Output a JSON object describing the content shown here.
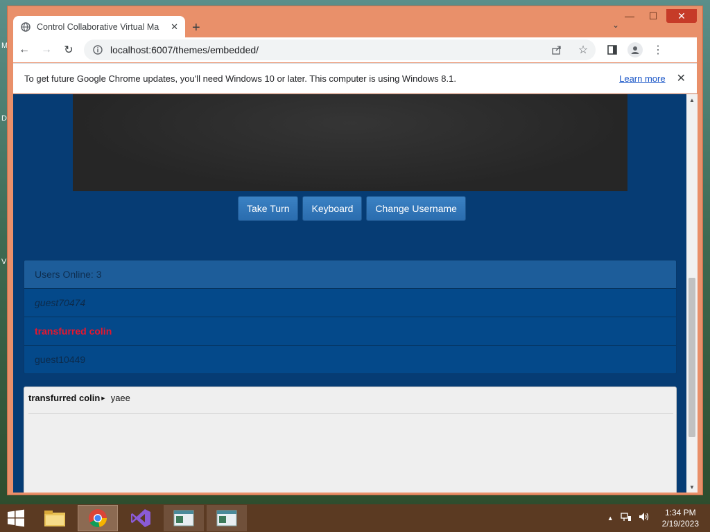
{
  "desktop": {
    "edge_letters": [
      "M",
      "D",
      "V"
    ]
  },
  "browser": {
    "tab": {
      "title": "Control Collaborative Virtual Ma",
      "favicon": "globe-icon"
    },
    "address": {
      "url": "localhost:6007/themes/embedded/"
    },
    "infobar": {
      "message": "To get future Google Chrome updates, you'll need Windows 10 or later. This computer is using Windows 8.1.",
      "link": "Learn more"
    }
  },
  "page": {
    "vm_buttons": [
      {
        "label": "Take Turn"
      },
      {
        "label": "Keyboard"
      },
      {
        "label": "Change Username"
      }
    ],
    "users": {
      "heading": "Users Online: 3",
      "list": [
        {
          "name": "guest70474",
          "style": "italic"
        },
        {
          "name": "transfurred colin",
          "style": "highlight"
        },
        {
          "name": "guest10449",
          "style": "normal"
        }
      ]
    },
    "chat": {
      "messages": [
        {
          "user": "transfurred colin",
          "text": "yaee"
        }
      ]
    }
  },
  "taskbar": {
    "time": "1:34 PM",
    "date": "2/19/2023"
  },
  "colors": {
    "window_frame": "#e9906a",
    "page_bg": "#063c74",
    "button_bg": "#2a6cae",
    "highlight_user": "#e8162e",
    "taskbar": "#5b3a22"
  }
}
